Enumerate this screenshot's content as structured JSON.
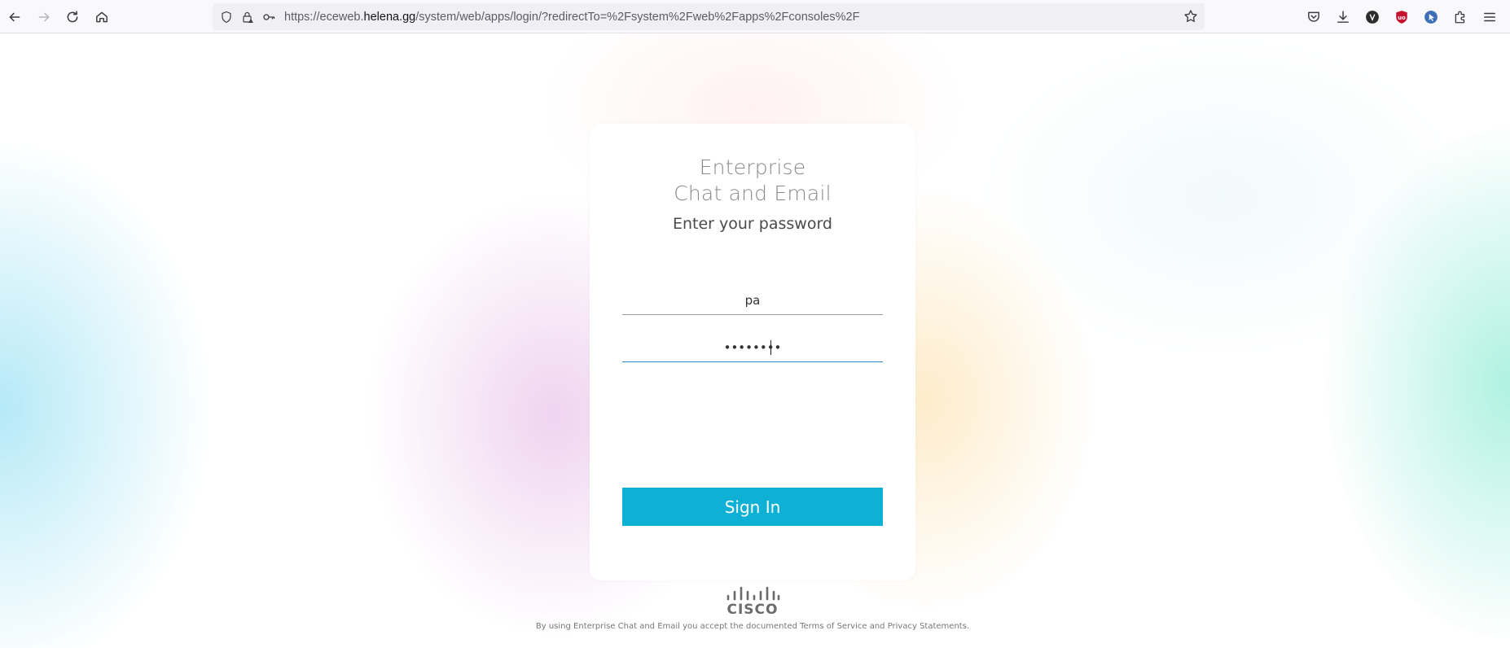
{
  "browser": {
    "url_prefix": "https://eceweb.",
    "url_host": "helena.gg",
    "url_path": "/system/web/apps/login/?redirectTo=%2Fsystem%2Fweb%2Fapps%2Fconsoles%2F",
    "nav_icons": [
      "back-icon",
      "forward-icon",
      "reload-icon",
      "home-icon"
    ],
    "toolbar_icons": [
      "pocket-icon",
      "download-icon",
      "extension-avatar-icon",
      "ublock-icon",
      "extension-cursor-icon",
      "extensions-icon",
      "menu-icon"
    ]
  },
  "login": {
    "app_title_line1": "Enterprise",
    "app_title_line2": "Chat and Email",
    "subtitle": "Enter your password",
    "username_value": "pa",
    "password_value": "••••••••",
    "signin_label": "Sign In"
  },
  "branding": {
    "logo_text": "CISCO"
  },
  "footer": {
    "text": "By using Enterprise Chat and Email you accept the documented Terms of Service and Privacy Statements."
  },
  "colors": {
    "accent": "#0fb0d5",
    "focus_underline": "#2b87c5"
  }
}
